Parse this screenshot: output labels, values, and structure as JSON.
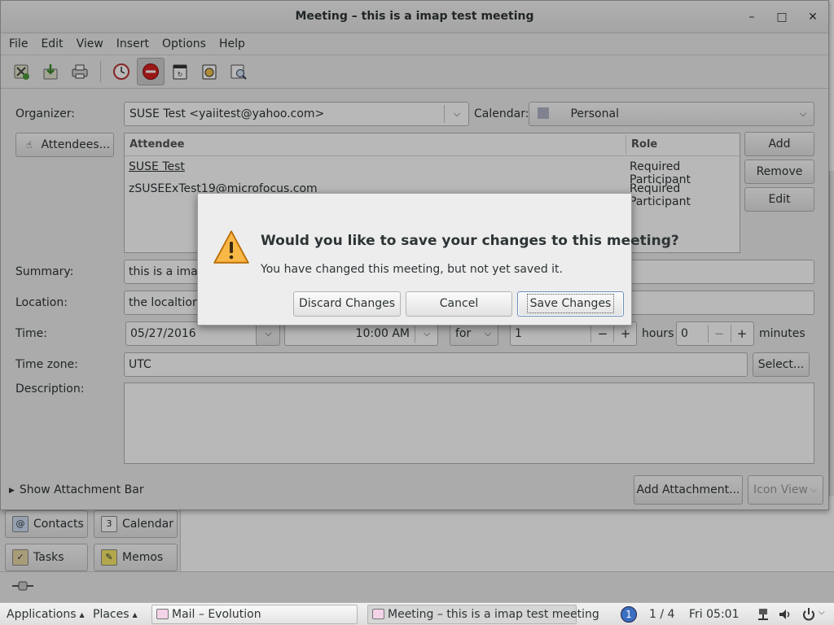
{
  "window": {
    "title": "Meeting – this is a imap test meeting",
    "minimize": "–",
    "maximize": "□",
    "close": "✕"
  },
  "menubar": [
    "File",
    "Edit",
    "View",
    "Insert",
    "Options",
    "Help"
  ],
  "toolbar": {
    "icons": [
      "save-close-icon",
      "save-icon",
      "print-icon",
      "alarm-icon",
      "show-busy-icon",
      "recurrence-icon",
      "all-day-icon",
      "free-busy-icon"
    ]
  },
  "form": {
    "organizer_label": "Organizer:",
    "organizer_value": "SUSE Test <yaiitest@yahoo.com>",
    "calendar_label": "Calendar:",
    "calendar_value": "Personal",
    "attendees_button": "Attendees...",
    "table": {
      "col_attendee": "Attendee",
      "col_role": "Role",
      "rows": [
        {
          "attendee": "SUSE Test",
          "role": "Required Participant"
        },
        {
          "attendee": "zSUSEExTest19@microfocus.com",
          "role": "Required Participant"
        }
      ]
    },
    "add": "Add",
    "remove": "Remove",
    "edit": "Edit",
    "summary_label": "Summary:",
    "summary_value": "this is a imap",
    "location_label": "Location:",
    "location_value": "the localtion",
    "time_label": "Time:",
    "date_value": "05/27/2016",
    "time_value": "10:00 AM",
    "for_value": "for",
    "hours_value": "1",
    "hours_label": "hours",
    "minutes_value": "0",
    "minutes_label": "minutes",
    "minus": "−",
    "plus": "+",
    "timezone_label": "Time zone:",
    "timezone_value": "UTC",
    "select_button": "Select...",
    "description_label": "Description:",
    "attachment_bar": "Show Attachment Bar",
    "add_attachment": "Add Attachment...",
    "icon_view": "Icon View"
  },
  "dialog": {
    "heading": "Would you like to save your changes to this meeting?",
    "message": "You have changed this meeting, but not yet saved it.",
    "discard": "Discard Changes",
    "cancel": "Cancel",
    "save": "Save Changes"
  },
  "switcher": {
    "contacts": "Contacts",
    "calendar": "Calendar",
    "tasks": "Tasks",
    "memos": "Memos"
  },
  "taskbar": {
    "applications": "Applications",
    "places": "Places",
    "task1": "Mail – Evolution",
    "task2": "Meeting – this is a imap test meeting",
    "workspace_badge": "1",
    "workspace": "1 / 4",
    "clock": "Fri 05:01"
  },
  "colors": {
    "warning": "#f0a030",
    "busy_red": "#d42020",
    "accent": "#6e8fbf"
  }
}
